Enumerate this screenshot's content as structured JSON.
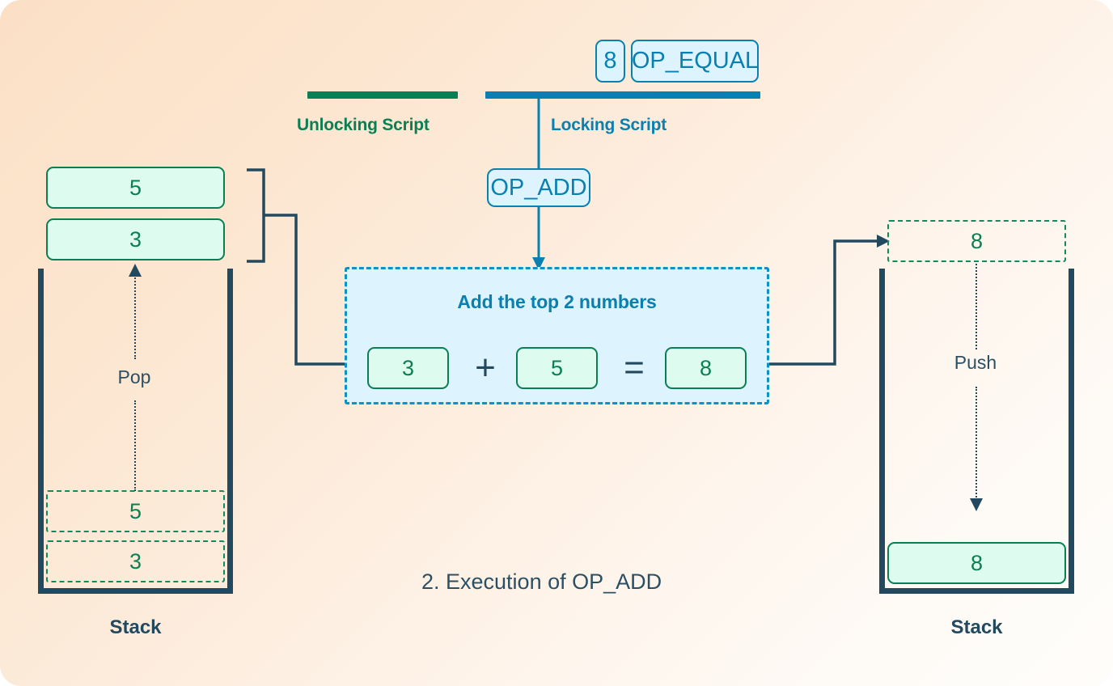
{
  "figure": {
    "caption": "2. Execution of OP_ADD"
  },
  "colors": {
    "green": "#0a7f54",
    "blue": "#0980b0",
    "dark": "#23495e",
    "mint_fill": "#ddfcef",
    "blue_fill": "#ddf3fd",
    "bg_start": "#fbe0c6",
    "bg_end": "#fffdfb"
  },
  "scripts": {
    "unlocking": {
      "label": "Unlocking Script",
      "items": []
    },
    "locking": {
      "label": "Locking Script",
      "remaining_items": [
        {
          "text": "8"
        },
        {
          "text": "OP_EQUAL"
        }
      ],
      "executing_item": {
        "text": "OP_ADD"
      }
    }
  },
  "left_stack": {
    "caption": "Stack",
    "popped_items": [
      {
        "value": "5"
      },
      {
        "value": "3"
      }
    ],
    "ghost_items": [
      {
        "value": "5"
      },
      {
        "value": "3"
      }
    ],
    "move_label": "Pop",
    "move_direction": "up"
  },
  "compute": {
    "title": "Add the top 2 numbers",
    "operands": [
      {
        "value": "3"
      },
      {
        "value": "5"
      }
    ],
    "operators": [
      {
        "symbol": "+",
        "name": "plus"
      },
      {
        "symbol": "=",
        "name": "equals"
      }
    ],
    "result": {
      "value": "8"
    }
  },
  "right_stack": {
    "caption": "Stack",
    "incoming_item": {
      "value": "8"
    },
    "move_label": "Push",
    "move_direction": "down",
    "pushed_item": {
      "value": "8"
    }
  }
}
